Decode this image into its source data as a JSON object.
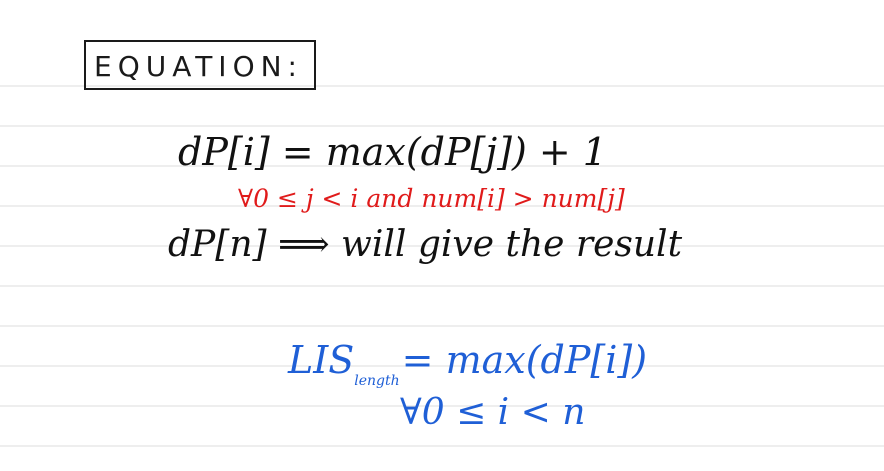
{
  "heading": "EQUATION:",
  "equation": {
    "main": "dP[i] = max(dP[j]) + 1",
    "condition": "∀0 ≤ j < i  and  num[i] > num[j]",
    "result": "dP[n] ⟹ will give the result"
  },
  "lis": {
    "prefix": "LIS",
    "subscript": "length",
    "formula": "= max(dP[i])",
    "range": "∀0 ≤ i < n"
  },
  "colors": {
    "ink": "#111111",
    "condition_ink": "#e01b1b",
    "lis_ink": "#1f5fd6",
    "rule_line": "#dcdcdc"
  }
}
